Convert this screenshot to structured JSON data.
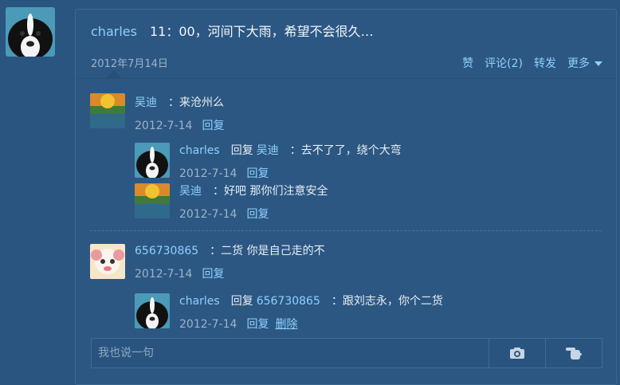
{
  "post": {
    "author": "charles",
    "text": "11：00，河间下大雨，希望不会很久…",
    "date": "2012年7月14日",
    "actions": {
      "like": "赞",
      "comment": "评论(2)",
      "repost": "转发",
      "more": "更多"
    }
  },
  "comments": [
    {
      "author": "吴迪",
      "text": "：来沧州么",
      "date": "2012-7-14",
      "reply": "回复",
      "replies": [
        {
          "author": "charles",
          "reply_prefix": "回复",
          "reply_to": "吴迪",
          "text": "：去不了了，绕个大弯",
          "date": "2012-7-14",
          "reply": "回复"
        },
        {
          "author": "吴迪",
          "text": "：好吧 那你们注意安全",
          "date": "2012-7-14",
          "reply": "回复"
        }
      ]
    },
    {
      "author": "656730865",
      "text": "：二货 你是自己走的不",
      "date": "2012-7-14",
      "reply": "回复",
      "replies": [
        {
          "author": "charles",
          "reply_prefix": "回复",
          "reply_to": "656730865",
          "text": "：跟刘志永，你个二货",
          "date": "2012-7-14",
          "reply": "回复",
          "delete": "删除"
        }
      ]
    }
  ],
  "reply_box": {
    "placeholder": "我也说一句"
  },
  "colors": {
    "background": "#2a5580",
    "link": "#8fd0ff",
    "muted": "#9db3c8"
  },
  "icons": {
    "camera": "camera-icon",
    "pointer": "pointing-hand-icon"
  }
}
